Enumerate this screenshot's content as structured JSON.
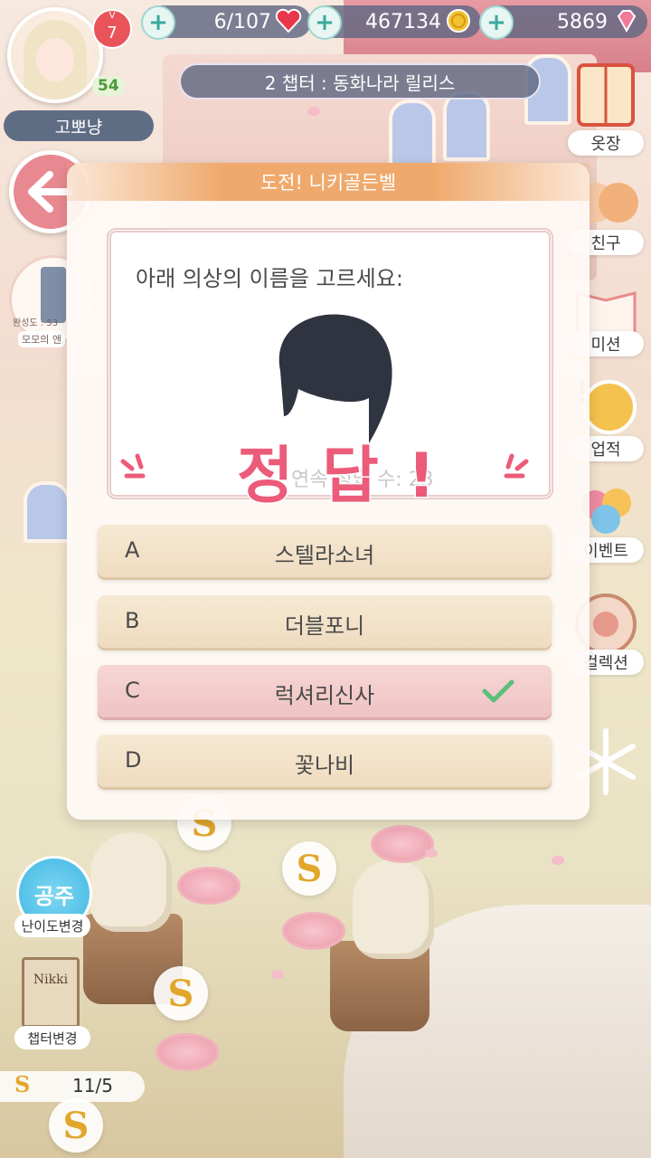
{
  "player": {
    "name": "고뽀냥",
    "vip_prefix": "V",
    "vip_level": "7",
    "level": "54"
  },
  "resources": {
    "hearts": "6/107",
    "gold": "467134",
    "diamonds": "5869"
  },
  "chapter_title": "2 챕터 :  동화나라 릴리스",
  "side_menu": [
    {
      "label": "옷장",
      "icon": "wardrobe-icon"
    },
    {
      "label": "친구",
      "icon": "friends-icon"
    },
    {
      "label": "미션",
      "icon": "mission-book-icon"
    },
    {
      "label": "업적",
      "icon": "achievement-medal-icon"
    },
    {
      "label": "이벤트",
      "icon": "balloons-icon"
    },
    {
      "label": "컬렉션",
      "icon": "collection-plate-icon"
    }
  ],
  "outfit": {
    "completion": "완성도 : 53",
    "name": "모모의 앤"
  },
  "quiz": {
    "banner": "도전! 니키골든벨",
    "question": "아래 의상의 이름을 고르세요:",
    "count_label": "연속 정답 수: ",
    "count_value": "23",
    "result": "정 답 !",
    "options": [
      {
        "letter": "A",
        "text": "스텔라소녀",
        "selected": false
      },
      {
        "letter": "B",
        "text": "더블포니",
        "selected": false
      },
      {
        "letter": "C",
        "text": "럭셔리신사",
        "selected": true
      },
      {
        "letter": "D",
        "text": "꽃나비",
        "selected": false
      }
    ]
  },
  "bottom_left": {
    "difficulty_badge": "공주",
    "difficulty_label": "난이도변경",
    "book_title": "Nikki",
    "chapter_label": "챕터변경",
    "progress": "11/5",
    "stage_icon": "S"
  },
  "colors": {
    "accent_pink": "#ec5b79",
    "ribbon_orange": "#efa96c",
    "hud_slate": "#606882",
    "correct_green": "#5cbf7a"
  }
}
